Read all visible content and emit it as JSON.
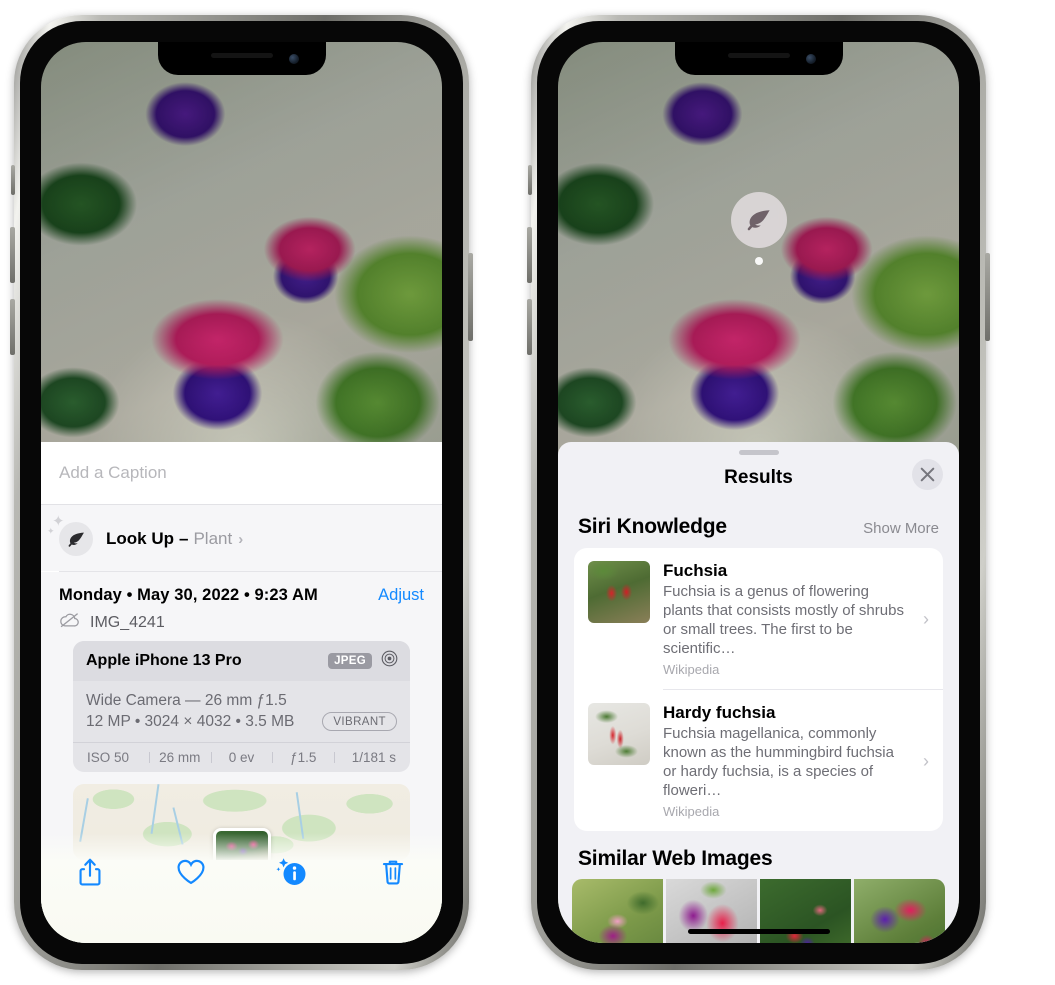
{
  "left_phone": {
    "caption": {
      "placeholder": "Add a Caption",
      "value": ""
    },
    "lookup": {
      "label": "Look Up",
      "dash": "–",
      "subject": "Plant",
      "chevron": "›",
      "icon": "leaf-icon",
      "sparkle": "✦"
    },
    "info": {
      "date": "Monday • May 30, 2022 • 9:23 AM",
      "adjust_label": "Adjust",
      "filename": "IMG_4241",
      "cloud_icon": "icloud-slash-icon"
    },
    "camera": {
      "device": "Apple iPhone 13 Pro",
      "format_badge": "JPEG",
      "lens_icon": "aperture-icon",
      "lens_line": "Wide Camera — 26 mm ƒ1.5",
      "spec_line": "12 MP • 3024 × 4032 • 3.5 MB",
      "style_badge": "VIBRANT",
      "exif": [
        "ISO 50",
        "26 mm",
        "0 ev",
        "ƒ1.5",
        "1/181 s"
      ]
    },
    "toolbar": [
      {
        "name": "share-button",
        "icon": "share-icon"
      },
      {
        "name": "favorite-button",
        "icon": "heart-icon"
      },
      {
        "name": "info-button",
        "icon": "info-sparkle-icon"
      },
      {
        "name": "delete-button",
        "icon": "trash-icon"
      }
    ],
    "accent_color": "#1389ff"
  },
  "right_phone": {
    "badge": {
      "icon": "leaf-icon",
      "name": "visual-lookup-badge"
    },
    "sheet": {
      "title": "Results",
      "close_label": "✕",
      "siri_section": {
        "title": "Siri Knowledge",
        "show_more": "Show More"
      },
      "knowledge_items": [
        {
          "title": "Fuchsia",
          "description": "Fuchsia is a genus of flowering plants that consists mostly of shrubs or small trees. The first to be scientific…",
          "source": "Wikipedia",
          "chevron": "›"
        },
        {
          "title": "Hardy fuchsia",
          "description": "Fuchsia magellanica, commonly known as the hummingbird fuchsia or hardy fuchsia, is a species of floweri…",
          "source": "Wikipedia",
          "chevron": "›"
        }
      ],
      "similar_section": {
        "title": "Similar Web Images"
      },
      "similar_images": [
        {
          "alt": "fuchsia-thumbnail-1"
        },
        {
          "alt": "fuchsia-thumbnail-2"
        },
        {
          "alt": "fuchsia-thumbnail-3"
        },
        {
          "alt": "fuchsia-thumbnail-4"
        }
      ]
    }
  },
  "photo": {
    "subject": "fuchsia flowers hanging basket"
  }
}
